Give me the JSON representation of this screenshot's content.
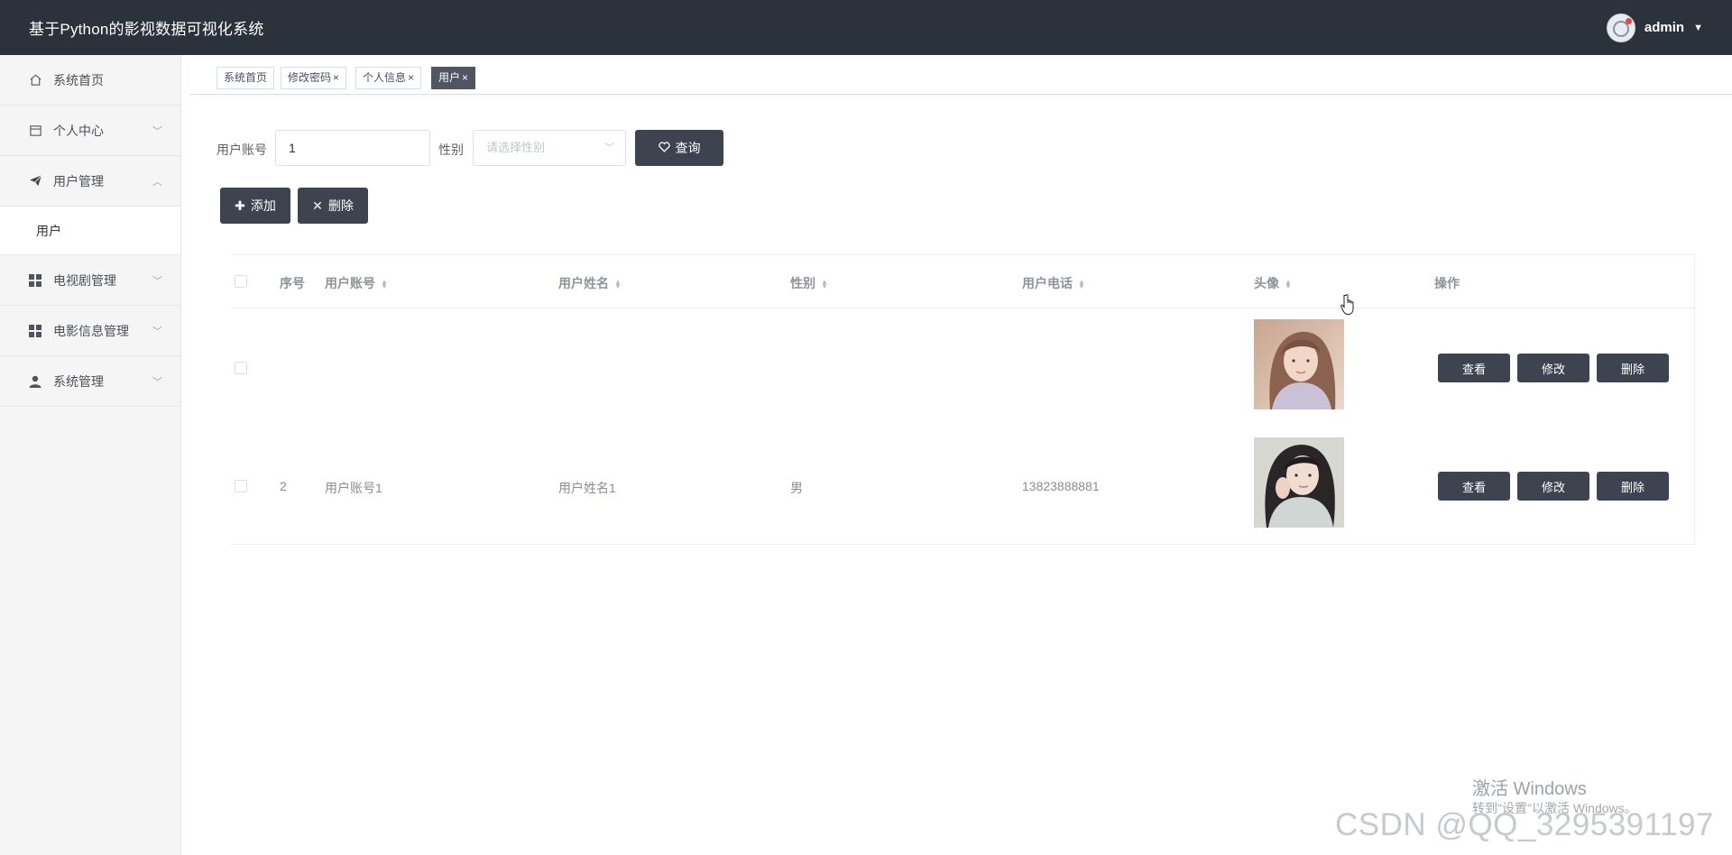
{
  "header": {
    "title": "基于Python的影视数据可视化系统",
    "username": "admin"
  },
  "sidebar": {
    "items": [
      {
        "label": "系统首页",
        "icon": "home-icon"
      },
      {
        "label": "个人中心",
        "icon": "calendar-icon",
        "arrow": "chevron-down"
      },
      {
        "label": "用户管理",
        "icon": "send-icon",
        "arrow": "chevron-up",
        "expanded": true
      },
      {
        "label": "电视剧管理",
        "icon": "grid-icon",
        "arrow": "chevron-down"
      },
      {
        "label": "电影信息管理",
        "icon": "grid-icon",
        "arrow": "chevron-down"
      },
      {
        "label": "系统管理",
        "icon": "user-icon",
        "arrow": "chevron-down"
      }
    ],
    "submenu": {
      "label": "用户"
    }
  },
  "tags": [
    {
      "label": "系统首页",
      "closable": false,
      "active": false
    },
    {
      "label": "修改密码",
      "closable": true,
      "active": false
    },
    {
      "label": "个人信息",
      "closable": true,
      "active": false
    },
    {
      "label": "用户",
      "closable": true,
      "active": true
    }
  ],
  "tag_close_glyph": "×",
  "search": {
    "account_label": "用户账号",
    "account_value": "1",
    "gender_label": "性别",
    "gender_placeholder": "请选择性别",
    "query_button": "查询"
  },
  "actions": {
    "add_button": "添加",
    "delete_button": "删除"
  },
  "table": {
    "columns": [
      "序号",
      "用户账号",
      "用户姓名",
      "性别",
      "用户电话",
      "头像",
      "操作"
    ],
    "rows": [
      {
        "index": "",
        "account": "",
        "name": "",
        "gender": "",
        "phone": ""
      },
      {
        "index": "2",
        "account": "用户账号1",
        "name": "用户姓名1",
        "gender": "男",
        "phone": "13823888881"
      }
    ],
    "op_labels": {
      "view": "查看",
      "edit": "修改",
      "delete": "删除"
    }
  },
  "watermarks": {
    "windows_line1": "激活 Windows",
    "windows_line2": "转到\"设置\"以激活 Windows。",
    "csdn": "CSDN @QQ_3295391197"
  },
  "colors": {
    "header_bg": "#2b323b",
    "button_bg": "#3d4450",
    "sidebar_bg": "#f5f5f5",
    "active_tag_bg": "#4f5661"
  }
}
